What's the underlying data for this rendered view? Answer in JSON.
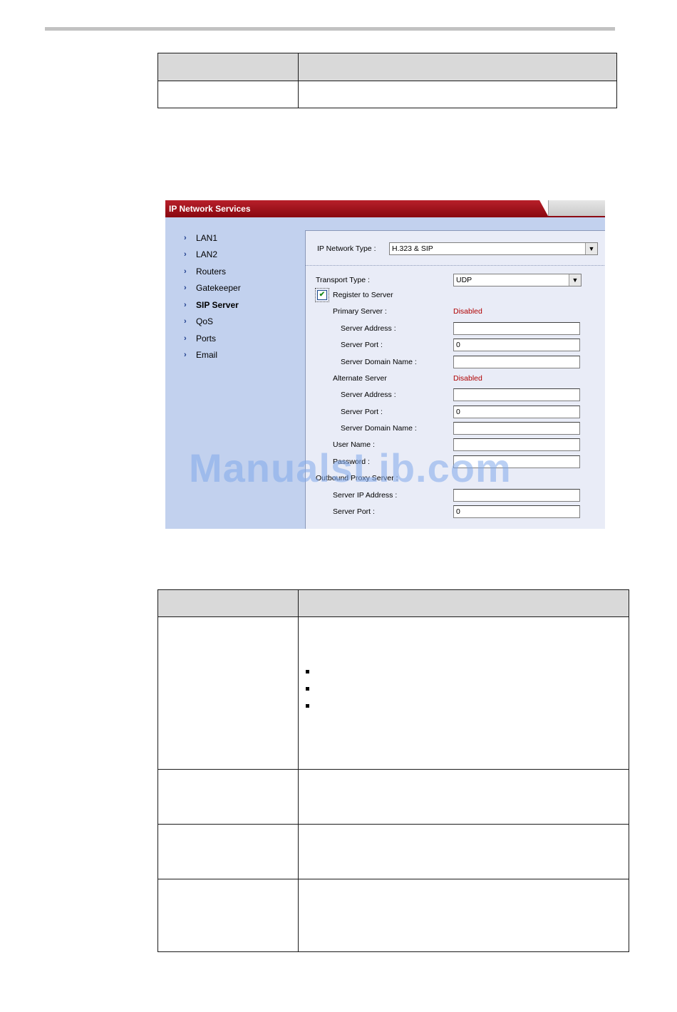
{
  "window": {
    "title": "IP Network Services"
  },
  "sidebar": {
    "items": [
      {
        "label": "LAN1"
      },
      {
        "label": "LAN2"
      },
      {
        "label": "Routers"
      },
      {
        "label": "Gatekeeper"
      },
      {
        "label": "SIP Server"
      },
      {
        "label": "QoS"
      },
      {
        "label": "Ports"
      },
      {
        "label": "Email"
      }
    ],
    "active": "SIP Server"
  },
  "form": {
    "ip_network_type_label": "IP Network Type :",
    "ip_network_type_value": "H.323 & SIP",
    "transport_type_label": "Transport Type :",
    "transport_type_value": "UDP",
    "register_label": "Register to Server",
    "register_checked": true,
    "primary_server_label": "Primary Server :",
    "primary_status": "Disabled",
    "primary_address_label": "Server Address :",
    "primary_address_value": "",
    "primary_port_label": "Server Port :",
    "primary_port_value": "0",
    "primary_domain_label": "Server Domain Name :",
    "primary_domain_value": "",
    "alternate_server_label": "Alternate Server",
    "alternate_status": "Disabled",
    "alternate_address_label": "Server Address :",
    "alternate_address_value": "",
    "alternate_port_label": "Server Port :",
    "alternate_port_value": "0",
    "alternate_domain_label": "Server Domain Name :",
    "alternate_domain_value": "",
    "user_name_label": "User Name :",
    "user_name_value": "",
    "password_label": "Password :",
    "password_value": "",
    "outbound_proxy_label": "Outbound Proxy Server :",
    "proxy_ip_label": "Server IP Address :",
    "proxy_ip_value": "",
    "proxy_port_label": "Server Port :",
    "proxy_port_value": "0"
  },
  "watermark": "ManualsLib.com",
  "colors": {
    "title_red": "#a3141c",
    "sidebar_blue": "#c2d1ee",
    "panel_bg": "#e9ecf7",
    "disabled_red": "#b00000",
    "table_header_grey": "#d9d9d9"
  }
}
